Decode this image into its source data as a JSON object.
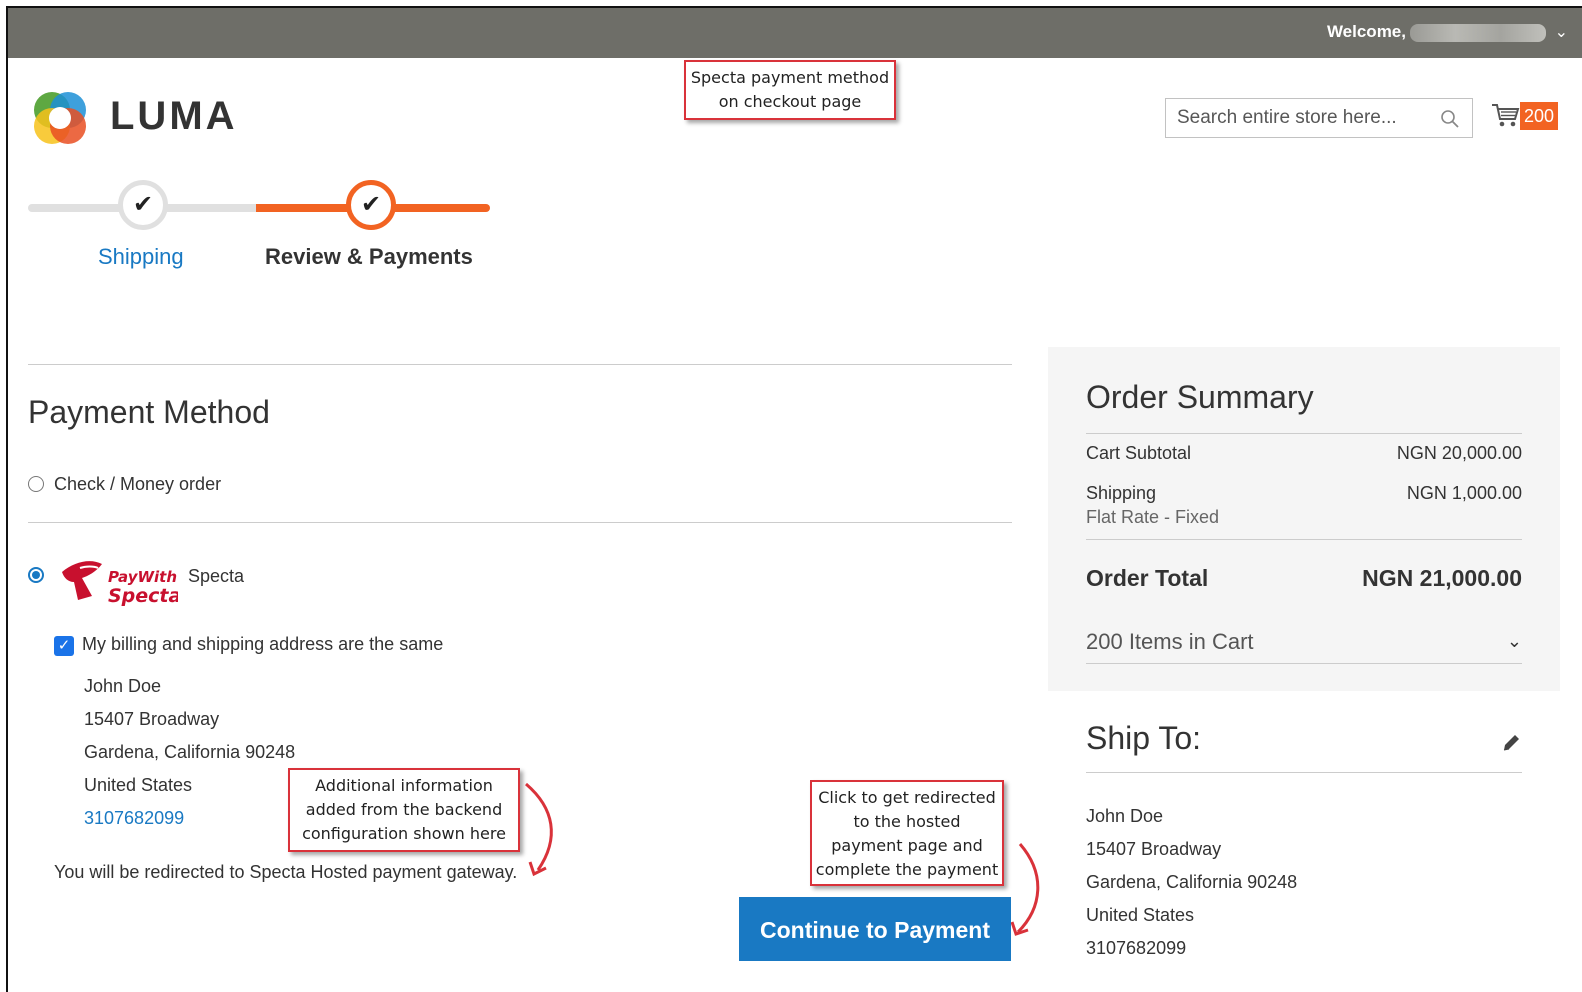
{
  "header": {
    "welcome": "Welcome,"
  },
  "brand": {
    "logo_text": "LUMA",
    "accent": "#f26322",
    "link": "#1979c3"
  },
  "search": {
    "placeholder": "Search entire store here..."
  },
  "cart": {
    "count": "200"
  },
  "progress": {
    "steps": [
      {
        "label": "Shipping",
        "state": "complete"
      },
      {
        "label": "Review & Payments",
        "state": "active"
      }
    ]
  },
  "payment": {
    "title": "Payment Method",
    "options": [
      {
        "label": "Check / Money order",
        "selected": false
      },
      {
        "label": "Specta",
        "selected": true,
        "logo_text_1": "PayWith",
        "logo_text_2": "Specta"
      }
    ],
    "billing_same_label": "My billing and shipping address are the same",
    "billing_checked": true,
    "address": {
      "name": "John Doe",
      "street": "15407 Broadway",
      "city": "Gardena, California 90248",
      "country": "United States",
      "phone": "3107682099"
    },
    "redirect_note": "You will be redirected to Specta Hosted payment gateway.",
    "continue_label": "Continue to Payment"
  },
  "summary": {
    "title": "Order Summary",
    "subtotal_label": "Cart Subtotal",
    "subtotal_value": "NGN 20,000.00",
    "shipping_label": "Shipping",
    "shipping_value": "NGN 1,000.00",
    "shipping_method": "Flat Rate - Fixed",
    "total_label": "Order Total",
    "total_value": "NGN 21,000.00",
    "items_in_cart": "200 Items in Cart"
  },
  "ship_to": {
    "title": "Ship To:",
    "name": "John Doe",
    "street": "15407 Broadway",
    "city": "Gardena, California 90248",
    "country": "United States",
    "phone": "3107682099"
  },
  "annotations": {
    "top_line1": "Specta payment method",
    "top_line2": "on checkout page",
    "info_line1": "Additional information",
    "info_line2": "added from the backend",
    "info_line3": "configuration shown here",
    "click_line1": "Click to get redirected",
    "click_line2": "to the hosted",
    "click_line3": "payment page and",
    "click_line4": "complete the payment",
    "color": "#d9323a"
  }
}
